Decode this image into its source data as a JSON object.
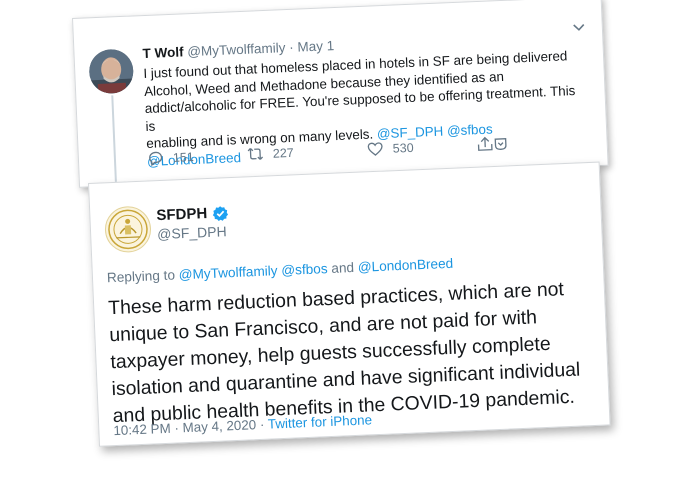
{
  "quoted_tweet": {
    "author_name": "T Wolf",
    "author_handle": "@MyTwolffamily",
    "separator": "·",
    "date": "May 1",
    "text_lines": [
      "I just found out that homeless placed in hotels in SF are being delivered",
      "Alcohol, Weed and Methadone because they identified as an",
      "addict/alcoholic for FREE. You're supposed to be offering treatment. This is",
      "enabling and is wrong on many levels."
    ],
    "mentions": [
      "@SF_DPH",
      "@sfbos",
      "@LondonBreed"
    ],
    "actions": {
      "replies": "151",
      "retweets": "227",
      "likes": "530"
    },
    "icons": [
      "avatar",
      "chevron-down-icon",
      "reply-icon",
      "retweet-icon",
      "like-icon",
      "share-icon"
    ]
  },
  "main_tweet": {
    "author_name": "SFDPH",
    "author_handle": "@SF_DPH",
    "replying_prefix": "Replying to",
    "replying_mentions": [
      "@MyTwolffamily",
      "@sfbos"
    ],
    "replying_and": "and",
    "replying_last": "@LondonBreed",
    "text_lines": [
      "These harm reduction based practices, which are not",
      "unique to San Francisco, and are not paid for with",
      "taxpayer money, help guests successfully complete",
      "isolation and quarantine and have significant individual",
      "and public health benefits in the COVID-19 pandemic."
    ],
    "timestamp": "10:42 PM · May 4, 2020",
    "meta_separator": "·",
    "source": "Twitter for iPhone",
    "icons": [
      "seal-avatar",
      "verified-icon"
    ]
  },
  "colors": {
    "link_blue": "#1b95e0",
    "muted_gray": "#657786",
    "text_dark": "#14171a",
    "verified_blue": "#1da1f2"
  }
}
